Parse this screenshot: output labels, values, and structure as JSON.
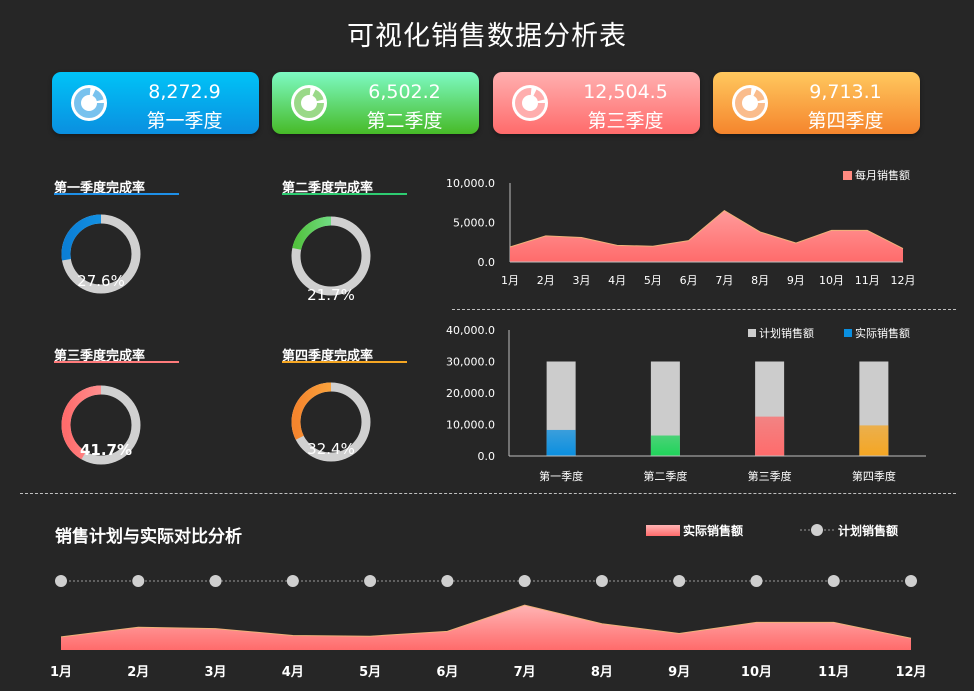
{
  "page_title": "可视化销售数据分析表",
  "cards": [
    {
      "value": "8,272.9",
      "label": "第一季度",
      "gradient": [
        "#00c3f7",
        "#0a8fe0"
      ],
      "icon": "donut-icon"
    },
    {
      "value": "6,502.2",
      "label": "第二季度",
      "gradient": [
        "#7dfac3",
        "#47ba27"
      ],
      "icon": "donut-icon"
    },
    {
      "value": "12,504.5",
      "label": "第三季度",
      "gradient": [
        "#ffb0b0",
        "#ff6b6b"
      ],
      "icon": "donut-icon"
    },
    {
      "value": "9,713.1",
      "label": "第四季度",
      "gradient": [
        "#ffc85e",
        "#f5852d"
      ],
      "icon": "donut-icon"
    }
  ],
  "gauges": [
    {
      "title": "第一季度完成率",
      "percent_label": "27.6%",
      "fraction": 0.276,
      "colors": [
        "#1aa3f0",
        "#0b7fd6"
      ],
      "line_color": "#1e90e8"
    },
    {
      "title": "第二季度完成率",
      "percent_label": "21.7%",
      "fraction": 0.217,
      "colors": [
        "#8ff5c8",
        "#52c23e"
      ],
      "line_color": "#2ecc71"
    },
    {
      "title": "第三季度完成率",
      "percent_label": "41.7%",
      "fraction": 0.417,
      "colors": [
        "#ffb3b3",
        "#ff6c6c"
      ],
      "line_color": "#ff7b7b"
    },
    {
      "title": "第四季度完成率",
      "percent_label": "32.4%",
      "fraction": 0.324,
      "colors": [
        "#ffc14d",
        "#f5852d"
      ],
      "line_color": "#f5a623"
    }
  ],
  "bottom_title": "销售计划与实际对比分析",
  "chart_data": [
    {
      "type": "area",
      "categories": [
        "1月",
        "2月",
        "3月",
        "4月",
        "5月",
        "6月",
        "7月",
        "8月",
        "9月",
        "10月",
        "11月",
        "12月"
      ],
      "series": [
        {
          "name": "每月销售额",
          "values": [
            1900,
            3300,
            3100,
            2100,
            2000,
            2700,
            6500,
            3800,
            2400,
            4000,
            4000,
            1700
          ],
          "color": "#ff8080"
        }
      ],
      "yticks": [
        "10,000.0",
        "5,000.0",
        "0.0"
      ],
      "ylim": [
        0,
        10000
      ],
      "legend": "top-right"
    },
    {
      "type": "bar",
      "categories": [
        "第一季度",
        "第二季度",
        "第三季度",
        "第四季度"
      ],
      "series": [
        {
          "name": "计划销售额",
          "values": [
            30000,
            30000,
            30000,
            30000
          ],
          "color": "#cccccc"
        },
        {
          "name": "实际销售额",
          "values": [
            8272.9,
            6502.2,
            12504.5,
            9713.1
          ],
          "colors": [
            "#0a8fe0",
            "#1fd45a",
            "#ff6b6b",
            "#f5a623"
          ]
        }
      ],
      "yticks": [
        "40,000.0",
        "30,000.0",
        "20,000.0",
        "10,000.0",
        "0.0"
      ],
      "ylim": [
        0,
        40000
      ],
      "legend": "top-right"
    },
    {
      "type": "area",
      "categories": [
        "1月",
        "2月",
        "3月",
        "4月",
        "5月",
        "6月",
        "7月",
        "8月",
        "9月",
        "10月",
        "11月",
        "12月"
      ],
      "series": [
        {
          "name": "实际销售额",
          "values": [
            1900,
            3300,
            3100,
            2100,
            2000,
            2700,
            6500,
            3800,
            2400,
            4000,
            4000,
            1700
          ],
          "color": "#ff8080"
        },
        {
          "name": "计划销售额",
          "values": [
            10000,
            10000,
            10000,
            10000,
            10000,
            10000,
            10000,
            10000,
            10000,
            10000,
            10000,
            10000
          ],
          "color": "#cccccc"
        }
      ],
      "ylim": [
        0,
        10000
      ],
      "legend": "top-right"
    }
  ]
}
